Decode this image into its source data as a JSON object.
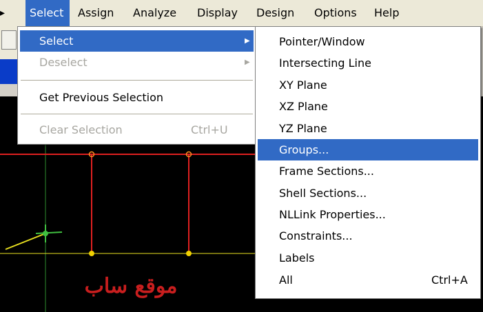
{
  "menubar": {
    "items": [
      {
        "label": "Select",
        "active": true
      },
      {
        "label": "Assign",
        "active": false
      },
      {
        "label": "Analyze",
        "active": false
      },
      {
        "label": "Display",
        "active": false
      },
      {
        "label": "Design",
        "active": false
      },
      {
        "label": "Options",
        "active": false
      },
      {
        "label": "Help",
        "active": false
      }
    ]
  },
  "select_menu": {
    "items": [
      {
        "label": "Select",
        "has_submenu": true,
        "highlighted": true,
        "enabled": true
      },
      {
        "label": "Deselect",
        "has_submenu": true,
        "highlighted": false,
        "enabled": false
      },
      {
        "label": "Get Previous Selection",
        "highlighted": false,
        "enabled": true
      },
      {
        "label": "Clear Selection",
        "shortcut": "Ctrl+U",
        "highlighted": false,
        "enabled": false
      }
    ]
  },
  "select_submenu": {
    "items": [
      {
        "label": "Pointer/Window"
      },
      {
        "label": "Intersecting Line"
      },
      {
        "label": "XY Plane"
      },
      {
        "label": "XZ Plane"
      },
      {
        "label": "YZ Plane"
      },
      {
        "label": "Groups...",
        "highlighted": true
      },
      {
        "label": "Frame Sections..."
      },
      {
        "label": "Shell Sections..."
      },
      {
        "label": "NLLink Properties..."
      },
      {
        "label": "Constraints..."
      },
      {
        "label": "Labels"
      },
      {
        "label": "All",
        "shortcut": "Ctrl+A"
      }
    ]
  },
  "canvas": {
    "watermark_text": "موقع ساب"
  },
  "colors": {
    "highlight": "#316ac5",
    "canvas_bg": "#000000",
    "frame_red": "#e02020",
    "grid_yellow": "#e8e020",
    "grid_green": "#40c040",
    "watermark": "#c81e1e"
  }
}
